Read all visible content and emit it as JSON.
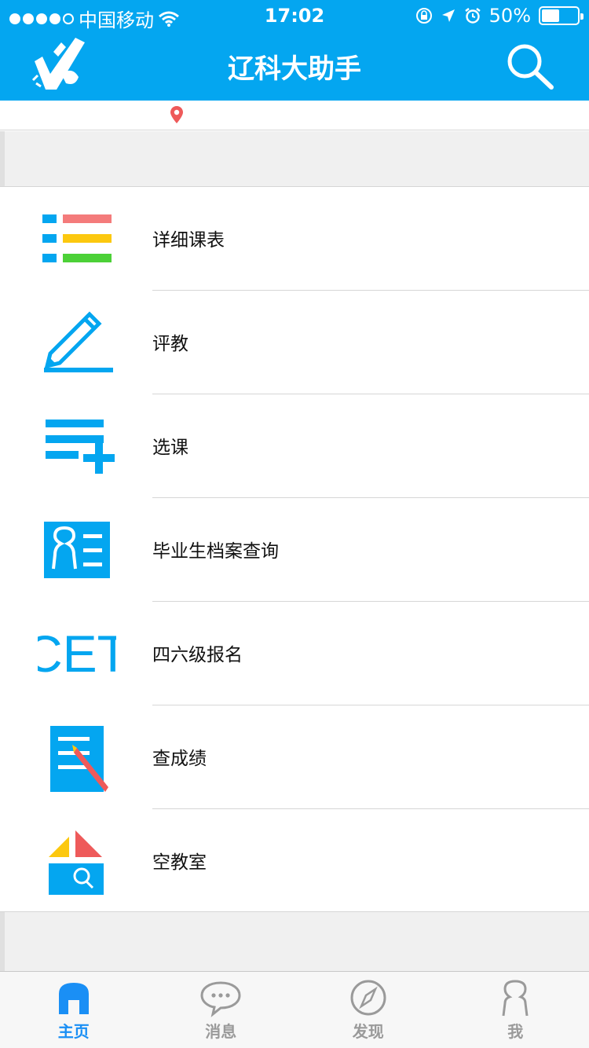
{
  "status": {
    "carrier": "中国移动",
    "time": "17:02",
    "battery_text": "50%",
    "battery_level": 0.5
  },
  "nav": {
    "title": "辽科大助手"
  },
  "menu": [
    {
      "label": "详细课表",
      "icon": "schedule-list-icon"
    },
    {
      "label": "评教",
      "icon": "pencil-edit-icon"
    },
    {
      "label": "选课",
      "icon": "list-add-icon"
    },
    {
      "label": "毕业生档案查询",
      "icon": "profile-card-icon"
    },
    {
      "label": "四六级报名",
      "icon": "cet-icon",
      "icon_text": "CET"
    },
    {
      "label": "查成绩",
      "icon": "score-document-icon"
    },
    {
      "label": "空教室",
      "icon": "classroom-search-icon"
    }
  ],
  "tabs": [
    {
      "label": "主页",
      "icon": "home-icon",
      "active": true
    },
    {
      "label": "消息",
      "icon": "message-icon",
      "active": false
    },
    {
      "label": "发现",
      "icon": "compass-icon",
      "active": false
    },
    {
      "label": "我",
      "icon": "person-icon",
      "active": false
    }
  ],
  "colors": {
    "primary": "#04a6f0",
    "tab_active": "#1a8ff5",
    "tab_inactive": "#9a9a9a",
    "red": "#f47b7b",
    "yellow": "#fcc80f",
    "green": "#4cd137"
  }
}
